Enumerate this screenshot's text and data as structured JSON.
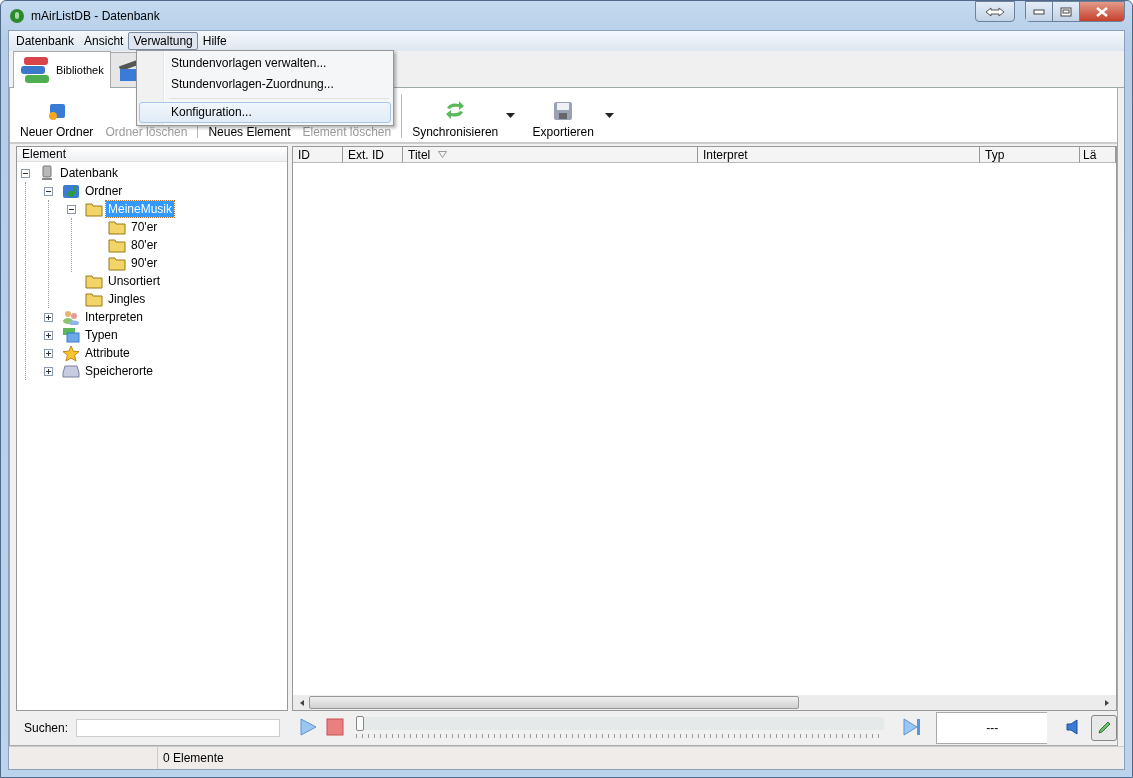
{
  "window": {
    "title": "mAirListDB - Datenbank"
  },
  "menu_bar": [
    {
      "label": "Datenbank",
      "selected": false
    },
    {
      "label": "Ansicht",
      "selected": false
    },
    {
      "label": "Verwaltung",
      "selected": true
    },
    {
      "label": "Hilfe",
      "selected": false
    }
  ],
  "open_menu": {
    "items": [
      {
        "kind": "item",
        "label": "Stundenvorlagen verwalten...",
        "highlighted": false
      },
      {
        "kind": "item",
        "label": "Stundenvorlagen-Zuordnung...",
        "highlighted": false
      },
      {
        "kind": "separator"
      },
      {
        "kind": "item",
        "label": "Konfiguration...",
        "highlighted": true
      }
    ]
  },
  "tabs": [
    {
      "label": "Bibliothek",
      "selected": true
    },
    {
      "selected": false
    }
  ],
  "toolbar": [
    {
      "kind": "button",
      "label": "Neuer Ordner",
      "disabled": false
    },
    {
      "kind": "button",
      "label": "Ordner löschen",
      "disabled": true
    },
    {
      "kind": "separator"
    },
    {
      "kind": "button",
      "label": "Neues Element",
      "disabled": false
    },
    {
      "kind": "button",
      "label": "Element löschen",
      "disabled": true
    },
    {
      "kind": "separator"
    },
    {
      "kind": "button",
      "label": "Synchronisieren",
      "disabled": false,
      "dropdown": true
    },
    {
      "kind": "button",
      "label": "Exportieren",
      "disabled": false,
      "dropdown": true
    }
  ],
  "tree": {
    "header": "Element",
    "items": [
      {
        "kind": "database",
        "label": "Datenbank",
        "selected": false,
        "expanded": true,
        "children": [
          {
            "kind": "folders",
            "label": "Ordner",
            "selected": false,
            "expanded": true,
            "children": [
              {
                "kind": "folder",
                "label": "MeineMusik",
                "selected": true,
                "expanded": true,
                "children": [
                  {
                    "kind": "folder",
                    "label": "70'er",
                    "selected": false
                  },
                  {
                    "kind": "folder",
                    "label": "80'er",
                    "selected": false
                  },
                  {
                    "kind": "folder",
                    "label": "90'er",
                    "selected": false
                  }
                ]
              },
              {
                "kind": "folder",
                "label": "Unsortiert",
                "selected": false
              },
              {
                "kind": "folder",
                "label": "Jingles",
                "selected": false
              }
            ]
          },
          {
            "kind": "artists",
            "label": "Interpreten",
            "selected": false,
            "expanded": false
          },
          {
            "kind": "types",
            "label": "Typen",
            "selected": false,
            "expanded": false
          },
          {
            "kind": "attributes",
            "label": "Attribute",
            "selected": false,
            "expanded": false
          },
          {
            "kind": "storage",
            "label": "Speicherorte",
            "selected": false,
            "expanded": false
          }
        ]
      }
    ]
  },
  "table": {
    "columns": [
      {
        "label": "ID",
        "sorted": false
      },
      {
        "label": "Ext. ID",
        "sorted": false
      },
      {
        "label": "Titel",
        "sorted": true
      },
      {
        "label": "Interpret",
        "sorted": false
      },
      {
        "label": "Typ",
        "sorted": false
      },
      {
        "label": "Lä",
        "sorted": false
      }
    ]
  },
  "search": {
    "label": "Suchen:"
  },
  "player": {
    "level": 0,
    "time": "---"
  },
  "status_bar": {
    "count": "0 Elemente"
  }
}
